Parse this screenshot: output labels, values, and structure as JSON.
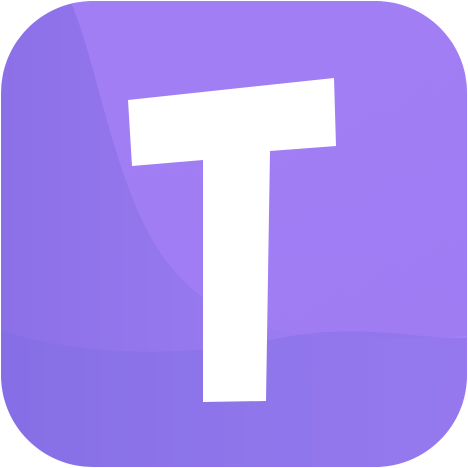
{
  "app_icon": {
    "name": "app-icon",
    "logo_letter": "T",
    "colors": {
      "background_light": "#a47ff5",
      "background_mid": "#9a7bf0",
      "background_dark": "#8c70e8",
      "wave_shadow": "#7a6ee2",
      "letter": "#ffffff",
      "page": "#ffffff"
    }
  }
}
